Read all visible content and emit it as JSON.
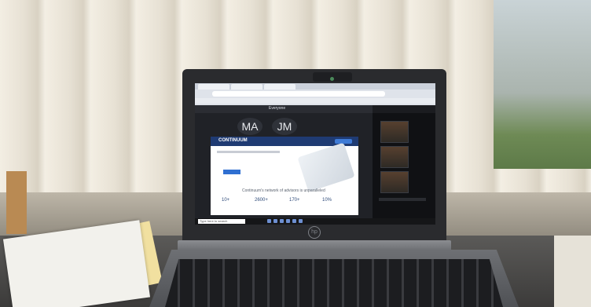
{
  "meeting": {
    "dropdown_label": "Everyone",
    "participants": [
      {
        "initials": "MA"
      },
      {
        "initials": "JM"
      }
    ]
  },
  "shared_screen": {
    "brand": "CONTINUUM",
    "tagline": "Continuum's network of advisors is unparalleled",
    "stats": [
      "10+",
      "2600+",
      "170+",
      "10%"
    ]
  },
  "taskbar": {
    "search_placeholder": "Type here to search"
  },
  "laptop": {
    "logo_text": "hp"
  }
}
